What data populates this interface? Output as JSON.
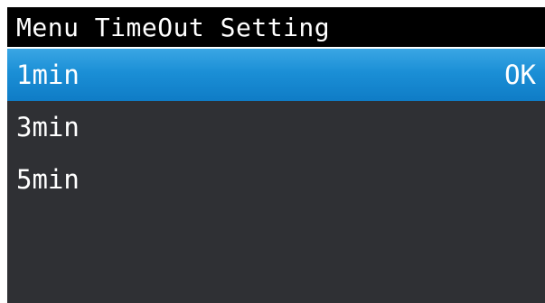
{
  "header": {
    "title": "Menu TimeOut Setting"
  },
  "menu": {
    "items": [
      {
        "label": "1min",
        "status": "OK",
        "selected": true
      },
      {
        "label": "3min",
        "status": "",
        "selected": false
      },
      {
        "label": "5min",
        "status": "",
        "selected": false
      }
    ]
  },
  "colors": {
    "title_background": "#000000",
    "screen_background": "#2f3034",
    "selected_highlight": "#1b8fd6",
    "text": "#ffffff"
  }
}
